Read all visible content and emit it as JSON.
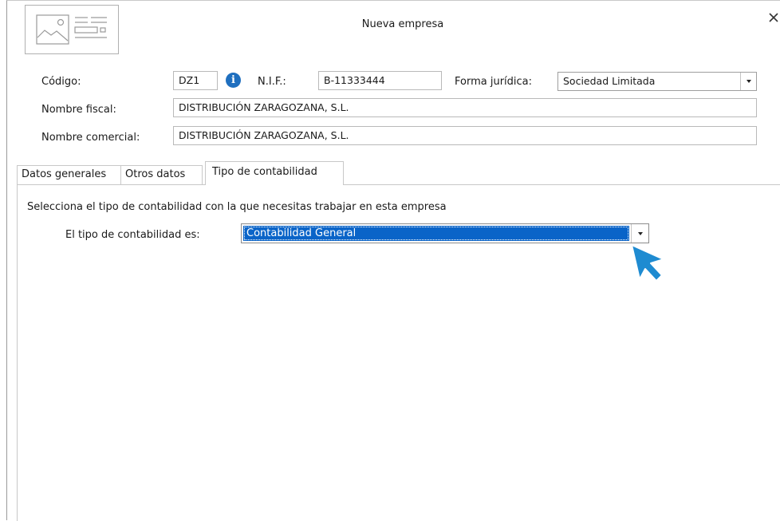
{
  "window": {
    "title": "Nueva empresa"
  },
  "header": {
    "codigo_label": "Código:",
    "codigo_value": "DZ1",
    "nif_label": "N.I.F.:",
    "nif_value": "B-11333444",
    "forma_label": "Forma jurídica:",
    "forma_value": "Sociedad Limitada",
    "nombre_fiscal_label": "Nombre fiscal:",
    "nombre_fiscal_value": "DISTRIBUCIÓN ZARAGOZANA, S.L.",
    "nombre_comercial_label": "Nombre comercial:",
    "nombre_comercial_value": "DISTRIBUCIÓN ZARAGOZANA, S.L."
  },
  "tabs": [
    {
      "label": "Datos generales",
      "active": false
    },
    {
      "label": "Otros datos",
      "active": false
    },
    {
      "label": "Tipo de contabilidad",
      "active": true
    }
  ],
  "panel": {
    "instruction": "Selecciona el tipo de contabilidad con la que necesitas trabajar en esta empresa",
    "tipo_label": "El tipo de contabilidad es:",
    "tipo_value": "Contabilidad General"
  },
  "icons": {
    "logo": "image-placeholder-icon",
    "close": "close-icon",
    "info": "info-icon",
    "cursor": "pointer-cursor-icon"
  },
  "colors": {
    "accent": "#0a64c8",
    "info": "#1f6fbf",
    "cursor": "#1e8bd1"
  }
}
